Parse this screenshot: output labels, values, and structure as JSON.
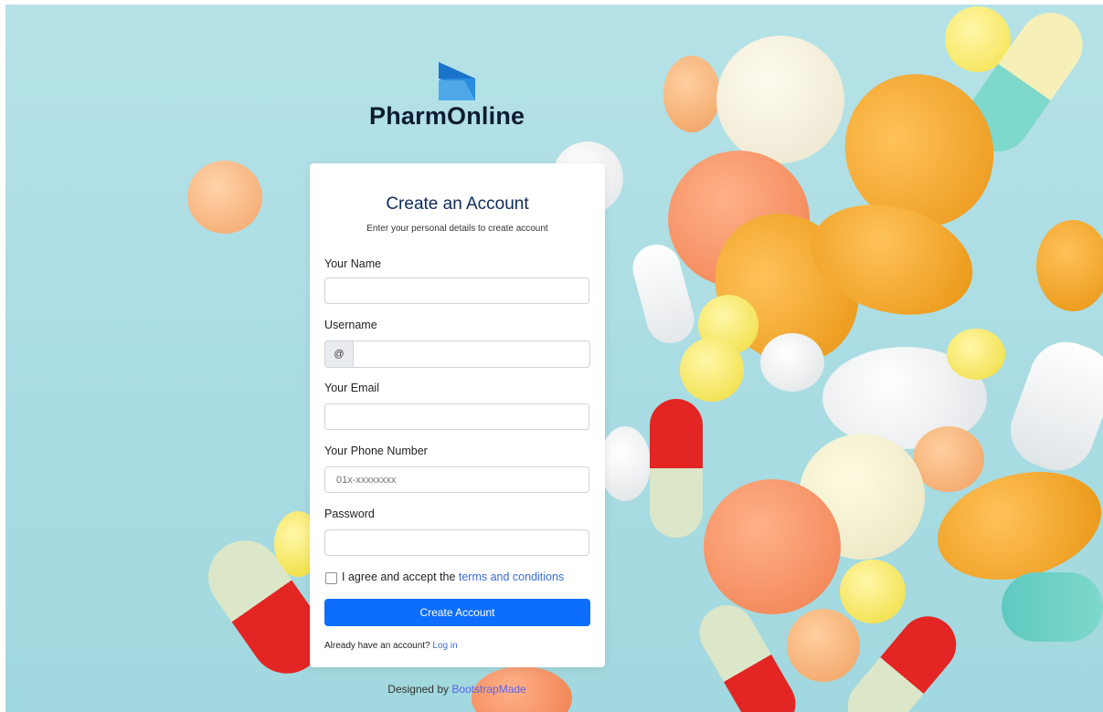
{
  "brand": {
    "name": "PharmOnline"
  },
  "card": {
    "title": "Create an Account",
    "subtitle": "Enter your personal details to create account"
  },
  "form": {
    "name_label": "Your Name",
    "username_label": "Username",
    "username_prefix": "@",
    "email_label": "Your Email",
    "phone_label": "Your Phone Number",
    "phone_placeholder": "01x-xxxxxxxx",
    "password_label": "Password",
    "agree_text": "I agree and accept the ",
    "terms_link": "terms and conditions",
    "submit_label": "Create Account",
    "already_text": "Already have an account? ",
    "login_link": "Log in"
  },
  "footer": {
    "designed_by": "Designed by ",
    "credit_link": "BootstrapMade"
  },
  "colors": {
    "primary": "#0d6efd",
    "link": "#3b6bd8",
    "title": "#0c2a5b",
    "background": "#a9dde3"
  }
}
